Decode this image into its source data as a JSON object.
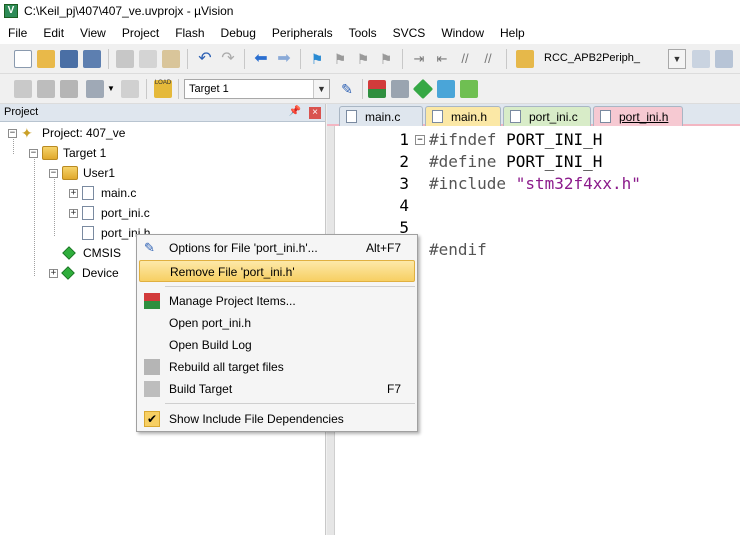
{
  "window": {
    "title": "C:\\Keil_pj\\407\\407_ve.uvprojx - µVision"
  },
  "menubar": [
    "File",
    "Edit",
    "View",
    "Project",
    "Flash",
    "Debug",
    "Peripherals",
    "Tools",
    "SVCS",
    "Window",
    "Help"
  ],
  "toolbar1": {
    "target_combo": "RCC_APB2Periph_"
  },
  "toolbar2": {
    "target_select": "Target 1"
  },
  "project_panel": {
    "title": "Project",
    "tree": {
      "project": "Project: 407_ve",
      "target": "Target 1",
      "group": "User1",
      "files": [
        "main.c",
        "port_ini.c",
        "port_ini.h"
      ],
      "components": [
        "CMSIS",
        "Device"
      ]
    }
  },
  "tabs": [
    {
      "label": "main.c",
      "color": "#dfe6ee"
    },
    {
      "label": "main.h",
      "color": "#fbe8a6"
    },
    {
      "label": "port_ini.c",
      "color": "#d8ecc8"
    },
    {
      "label": "port_ini.h",
      "color": "#f6c9d2",
      "active": true
    }
  ],
  "editor": {
    "line_numbers": [
      "1",
      "2",
      "3",
      "4",
      "5"
    ],
    "lines": [
      {
        "kw": "#ifndef",
        "rest": " PORT_INI_H"
      },
      {
        "kw": "#define",
        "rest": " PORT_INI_H"
      },
      {
        "kw": "#include",
        "str": " \"stm32f4xx.h\""
      },
      {
        "kw": "",
        "rest": ""
      },
      {
        "kw": "",
        "rest": ""
      },
      {
        "kw": "#endif",
        "rest": ""
      }
    ]
  },
  "context_menu": {
    "items": [
      {
        "label": "Options for File 'port_ini.h'...",
        "shortcut": "Alt+F7"
      },
      {
        "label": "Remove File 'port_ini.h'",
        "shortcut": "",
        "highlighted": true
      },
      {
        "label": "Manage Project Items...",
        "shortcut": ""
      },
      {
        "label": "Open port_ini.h",
        "shortcut": ""
      },
      {
        "label": "Open Build Log",
        "shortcut": ""
      },
      {
        "label": "Rebuild all target files",
        "shortcut": ""
      },
      {
        "label": "Build Target",
        "shortcut": "F7"
      },
      {
        "label": "Show Include File Dependencies",
        "shortcut": "",
        "checked": true
      }
    ]
  }
}
